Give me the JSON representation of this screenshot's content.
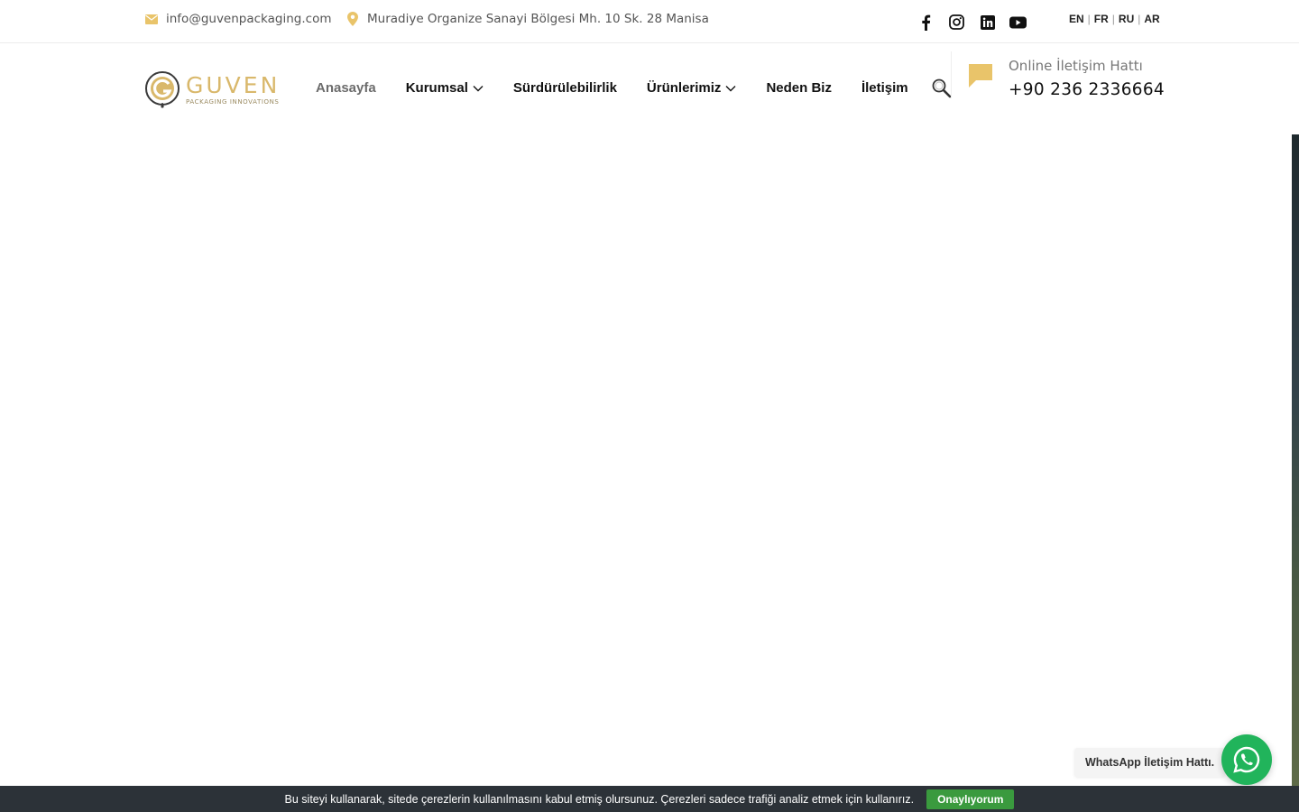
{
  "topbar": {
    "email": "info@guvenpackaging.com",
    "address": "Muradiye Organize Sanayi Bölgesi Mh. 10 Sk. 28 Manisa",
    "languages": [
      "EN",
      "FR",
      "RU",
      "AR"
    ],
    "social": [
      "facebook-icon",
      "instagram-icon",
      "linkedin-icon",
      "youtube-icon"
    ]
  },
  "header": {
    "logo_word": "GUVEN",
    "logo_sub": "PACKAGING INNOVATIONS",
    "nav": [
      {
        "label": "Anasayfa",
        "active": true
      },
      {
        "label": "Kurumsal",
        "dropdown": true
      },
      {
        "label": "Sürdürülebilirlik"
      },
      {
        "label": "Ürünlerimiz",
        "dropdown": true
      },
      {
        "label": "Neden Biz"
      },
      {
        "label": "İletişim"
      }
    ],
    "hotline_label": "Online İletişim Hattı",
    "hotline_phone": "+90 236 2336664"
  },
  "whatsapp": {
    "label": "WhatsApp İletişim Hattı."
  },
  "cookie": {
    "text": "Bu siteyi kullanarak, sitede çerezlerin kullanılmasını kabul etmiş olursunuz. Çerezleri sadece trafiği analiz etmek için kullanırız.",
    "button": "Onaylıyorum"
  },
  "colors": {
    "accent_gold": "#d9b86b",
    "icon_gold": "#e9c46a",
    "whatsapp_green": "#21b45b",
    "cookie_bg": "#2c3238",
    "cookie_button": "#3a9a3e"
  }
}
